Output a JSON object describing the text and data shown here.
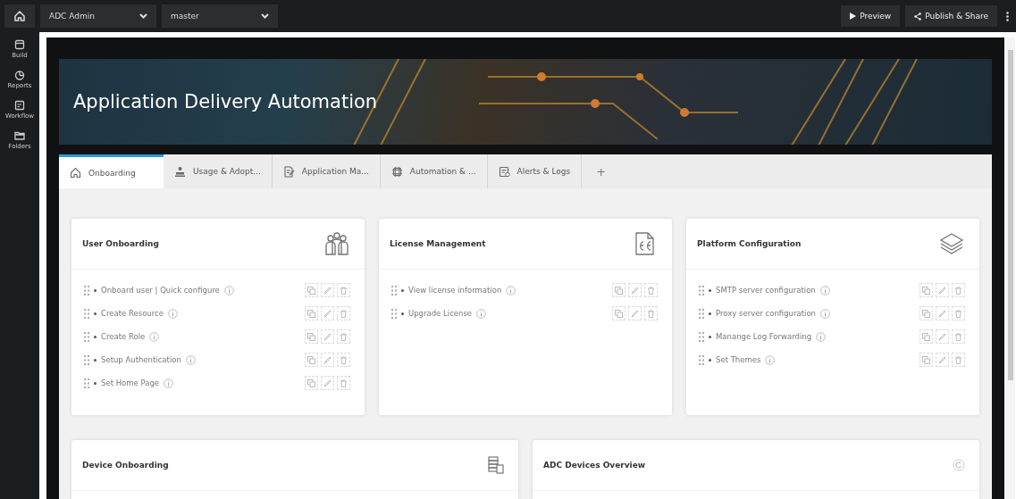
{
  "top_bar": {
    "app_selector": "ADC Admin",
    "branch_selector": "master",
    "buttons": [
      {
        "label": "Preview",
        "kind": "preview"
      },
      {
        "label": "Publish & Share",
        "kind": "share"
      }
    ]
  },
  "sidebar": {
    "items": [
      {
        "label": "Build",
        "kind": "build"
      },
      {
        "label": "Reports",
        "kind": "reports"
      },
      {
        "label": "Workflow",
        "kind": "workflow"
      },
      {
        "label": "Folders",
        "kind": "folders"
      }
    ]
  },
  "banner": {
    "title": "Application Delivery Automation"
  },
  "tabs": [
    {
      "label": "Onboarding",
      "kind": "home",
      "selected": true
    },
    {
      "label": "Usage & Adopt...",
      "kind": "usage",
      "selected": false
    },
    {
      "label": "Application Ma...",
      "kind": "app",
      "selected": false
    },
    {
      "label": "Automation & ...",
      "kind": "automation",
      "selected": false
    },
    {
      "label": "Alerts & Logs",
      "kind": "alerts",
      "selected": false
    }
  ],
  "add_tab": "+",
  "cards": [
    {
      "title": "User Onboarding",
      "kind": "users",
      "items": [
        "Onboard user | Quick configure",
        "Create Resource",
        "Create Role",
        "Setup Authentication",
        "Set Home Page"
      ]
    },
    {
      "title": "License Management",
      "kind": "license",
      "items": [
        "View license information",
        "Upgrade License"
      ]
    },
    {
      "title": "Platform Configuration",
      "kind": "layers",
      "items": [
        "SMTP server configuration",
        "Proxy server configuration",
        "Manange Log Forwarding",
        "Set Themes"
      ]
    }
  ],
  "bottom_cards": [
    {
      "title": "Device Onboarding",
      "kind": "devices"
    },
    {
      "title": "ADC Devices Overview",
      "kind": "refresh"
    }
  ]
}
